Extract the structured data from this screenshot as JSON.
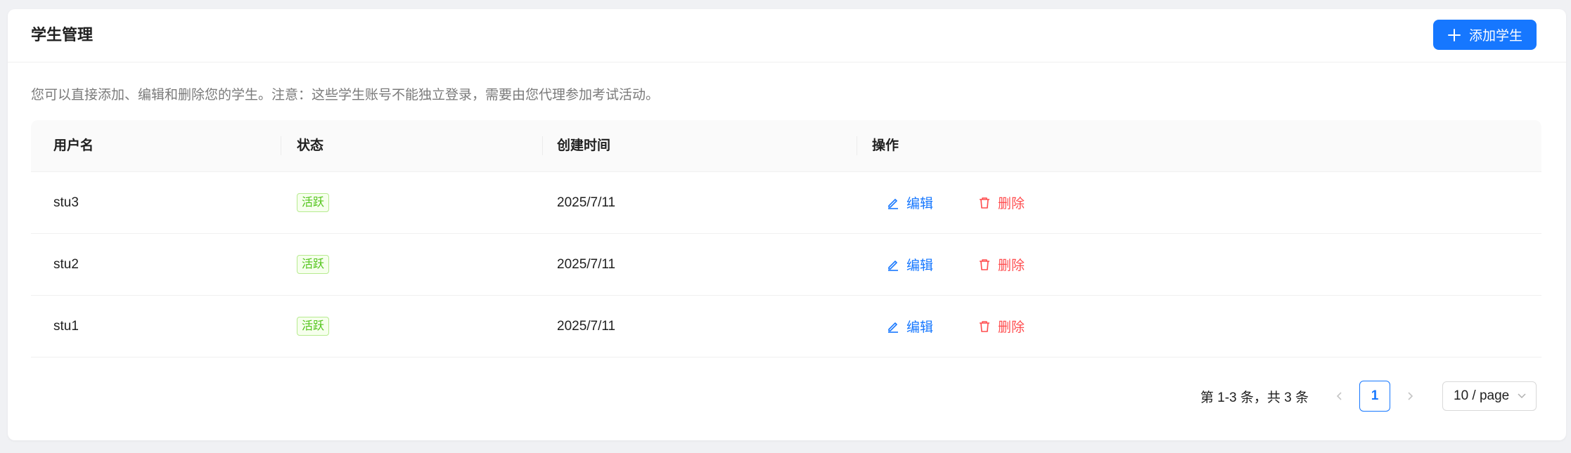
{
  "header": {
    "title": "学生管理",
    "add_button_label": "添加学生"
  },
  "description": "您可以直接添加、编辑和删除您的学生。注意：这些学生账号不能独立登录，需要由您代理参加考试活动。",
  "table": {
    "columns": [
      "用户名",
      "状态",
      "创建时间",
      "操作"
    ],
    "rows": [
      {
        "username": "stu3",
        "status": "活跃",
        "created": "2025/7/11",
        "edit": "编辑",
        "delete": "删除"
      },
      {
        "username": "stu2",
        "status": "活跃",
        "created": "2025/7/11",
        "edit": "编辑",
        "delete": "删除"
      },
      {
        "username": "stu1",
        "status": "活跃",
        "created": "2025/7/11",
        "edit": "编辑",
        "delete": "删除"
      }
    ]
  },
  "pagination": {
    "total_text": "第 1-3 条，共 3 条",
    "current_page": "1",
    "page_size": "10 / page"
  },
  "colors": {
    "primary": "#1677ff",
    "danger": "#ff4d4f",
    "success": "#52c41a"
  }
}
